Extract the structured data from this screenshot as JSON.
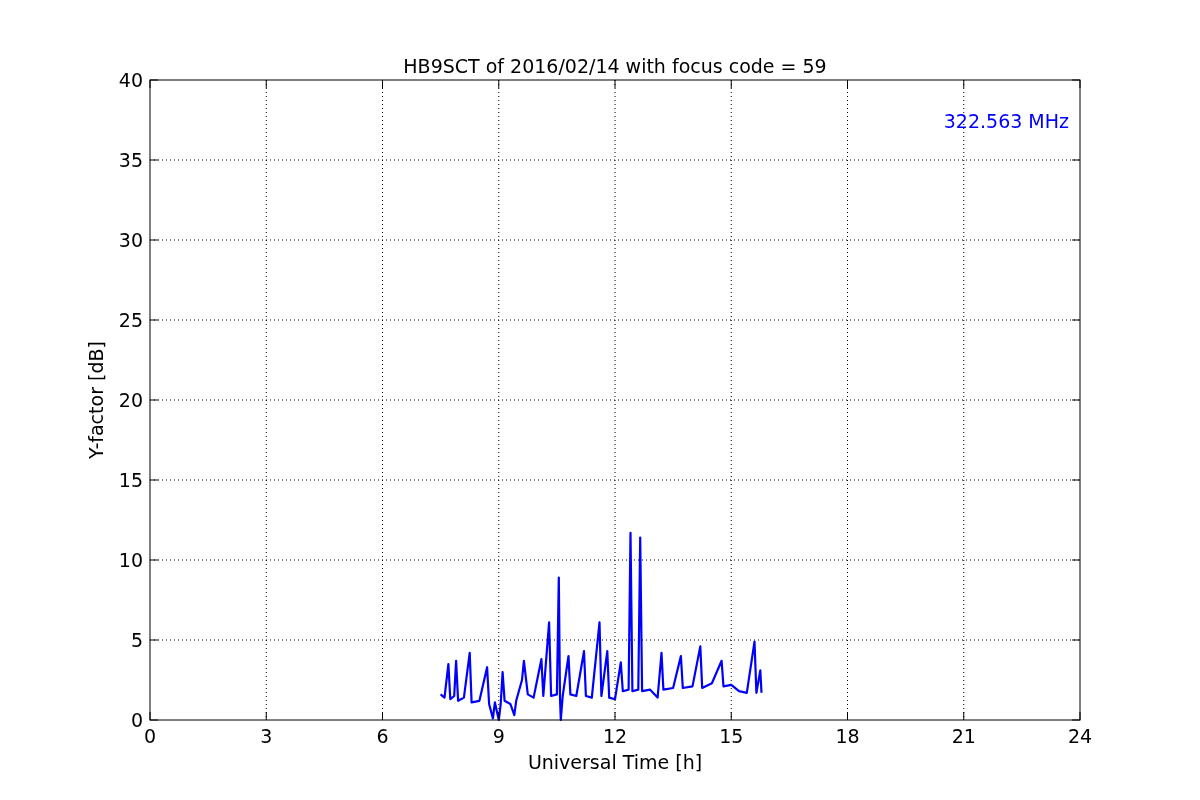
{
  "chart_data": {
    "type": "line",
    "title": "HB9SCT of 2016/02/14 with focus code = 59",
    "xlabel": "Universal Time [h]",
    "ylabel": "Y-factor [dB]",
    "xlim": [
      0,
      24
    ],
    "ylim": [
      0,
      40
    ],
    "xticks": [
      0,
      3,
      6,
      9,
      12,
      15,
      18,
      21,
      24
    ],
    "yticks": [
      0,
      5,
      10,
      15,
      20,
      25,
      30,
      35,
      40
    ],
    "x": [
      7.5,
      7.6,
      7.7,
      7.75,
      7.85,
      7.9,
      7.95,
      8.1,
      8.25,
      8.3,
      8.5,
      8.7,
      8.75,
      8.85,
      8.9,
      9.0,
      9.05,
      9.1,
      9.15,
      9.3,
      9.4,
      9.45,
      9.6,
      9.65,
      9.75,
      9.9,
      10.1,
      10.15,
      10.3,
      10.35,
      10.5,
      10.55,
      10.58,
      10.6,
      10.65,
      10.8,
      10.85,
      11.0,
      11.2,
      11.25,
      11.4,
      11.6,
      11.65,
      11.8,
      11.85,
      12.0,
      12.15,
      12.2,
      12.35,
      12.4,
      12.45,
      12.6,
      12.65,
      12.7,
      12.9,
      13.1,
      13.2,
      13.25,
      13.5,
      13.7,
      13.75,
      14.0,
      14.2,
      14.25,
      14.5,
      14.75,
      14.8,
      15.0,
      15.2,
      15.4,
      15.6,
      15.65,
      15.75,
      15.78
    ],
    "series": [
      {
        "name": "322.563 MHz",
        "color": "#0000ff",
        "values": [
          1.6,
          1.4,
          3.5,
          1.3,
          1.5,
          3.7,
          1.2,
          1.4,
          4.2,
          1.1,
          1.2,
          3.3,
          1.0,
          0.1,
          1.1,
          0.0,
          1.0,
          3.0,
          1.2,
          1.0,
          0.3,
          1.2,
          2.5,
          3.7,
          1.6,
          1.4,
          3.8,
          1.5,
          6.1,
          1.5,
          1.6,
          8.9,
          1.4,
          0.0,
          1.5,
          4.0,
          1.6,
          1.5,
          4.3,
          1.5,
          1.4,
          6.1,
          1.5,
          4.3,
          1.4,
          1.3,
          3.6,
          1.8,
          1.9,
          11.7,
          1.8,
          1.9,
          11.4,
          1.8,
          1.9,
          1.4,
          4.2,
          1.9,
          2.0,
          4.0,
          2.0,
          2.1,
          4.6,
          2.0,
          2.3,
          3.7,
          2.1,
          2.2,
          1.8,
          1.7,
          4.9,
          1.7,
          3.1,
          1.7
        ]
      }
    ],
    "grid": true
  }
}
